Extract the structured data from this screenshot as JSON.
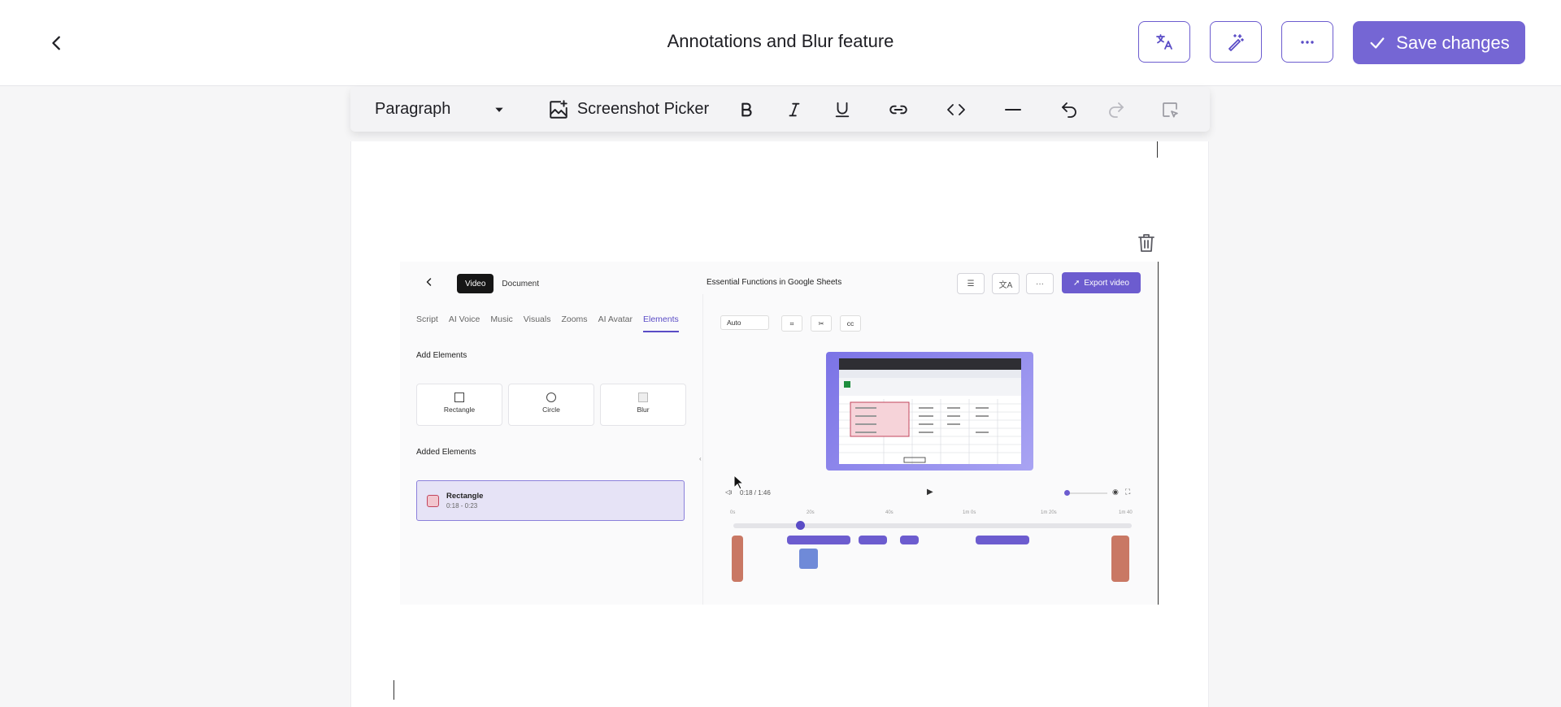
{
  "header": {
    "title": "Annotations and Blur feature",
    "save_label": "Save changes",
    "icons": [
      "chevron-left-icon",
      "translate-icon",
      "magic-wand-icon",
      "more-horizontal-icon",
      "check-icon"
    ],
    "accent_color": "#7566d4"
  },
  "toolbar": {
    "block_type": "Paragraph",
    "screenshot_picker_label": "Screenshot Picker",
    "icons": [
      "bold-icon",
      "italic-icon",
      "underline-icon",
      "link-icon",
      "code-icon",
      "horizontal-rule-icon",
      "undo-icon",
      "redo-icon",
      "select-icon"
    ]
  },
  "embedded_screenshot": {
    "segment": {
      "video": "Video",
      "document": "Document"
    },
    "title": "Essential Functions in Google Sheets",
    "export_label": "Export video",
    "tabs": [
      "Script",
      "AI Voice",
      "Music",
      "Visuals",
      "Zooms",
      "AI Avatar",
      "Elements"
    ],
    "active_tab": "Elements",
    "add_elements_heading": "Add Elements",
    "element_cards": [
      "Rectangle",
      "Circle",
      "Blur"
    ],
    "added_elements_heading": "Added Elements",
    "added_element": {
      "name": "Rectangle",
      "range": "0:18 - 0:23"
    },
    "aspect_select": "Auto",
    "time_display": "0:18 / 1:46",
    "timeline_ticks": [
      "0s",
      "20s",
      "40s",
      "1m 0s",
      "1m 20s",
      "1m 40"
    ]
  }
}
